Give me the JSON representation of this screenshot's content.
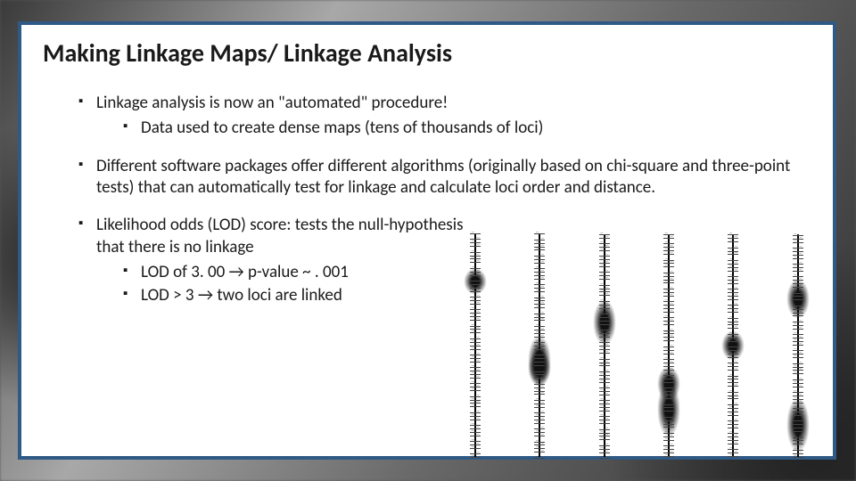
{
  "title": "Making Linkage Maps/ Linkage Analysis",
  "bullets": {
    "b1": "Linkage analysis is now an \"automated\" procedure!",
    "b1a": "Data used to create dense maps (tens of thousands of loci)",
    "b2": "Different software packages offer different algorithms (originally based on chi-square and three-point tests) that can automatically test for linkage and calculate loci order and distance.",
    "b3": "Likelihood odds (LOD) score: tests the null-hypothesis that there is no linkage",
    "b3a": "LOD of 3. 00 → p-value ~ . 001",
    "b3b": "LOD > 3 → two loci are linked"
  },
  "illustration": {
    "alt": "dense genetic linkage maps — six vertical chromosomes with many locus labels"
  }
}
